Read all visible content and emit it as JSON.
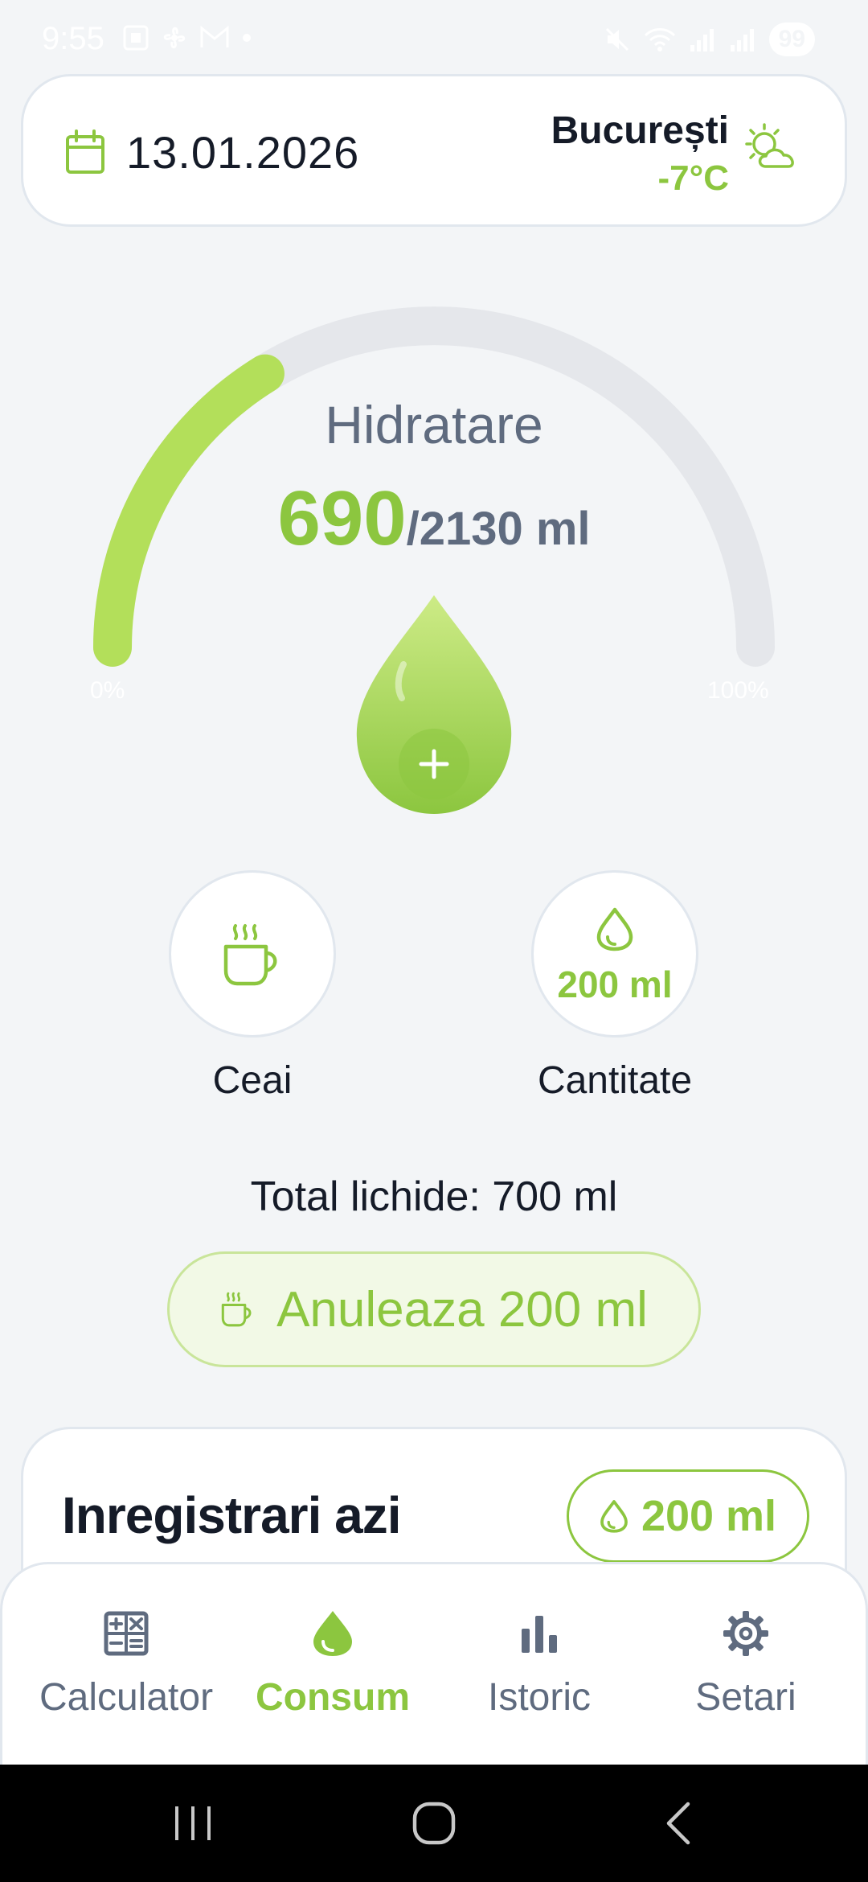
{
  "status_bar": {
    "time": "9:55",
    "battery": "99"
  },
  "header": {
    "date": "13.01.2026",
    "city": "București",
    "temperature": "-7°C"
  },
  "gauge": {
    "title": "Hidratare",
    "current": "690",
    "goal": "/2130 ml",
    "min_label": "0%",
    "max_label": "100%",
    "progress": 0.324
  },
  "quick": {
    "tea_label": "Ceai",
    "quantity_value": "200 ml",
    "quantity_label": "Cantitate"
  },
  "total": {
    "text": "Total lichide: 700 ml"
  },
  "undo": {
    "label": "Anuleaza 200 ml"
  },
  "records": {
    "title": "Inregistrari azi",
    "chip": "200 ml"
  },
  "nav": {
    "items": [
      {
        "label": "Calculator",
        "icon": "calculator-icon"
      },
      {
        "label": "Consum",
        "icon": "drop-icon"
      },
      {
        "label": "Istoric",
        "icon": "bar-chart-icon"
      },
      {
        "label": "Setari",
        "icon": "gear-icon"
      }
    ],
    "active": "Consum"
  },
  "colors": {
    "accent": "#8cc63f",
    "muted": "#5f6b7f",
    "background": "#f3f5f7"
  }
}
